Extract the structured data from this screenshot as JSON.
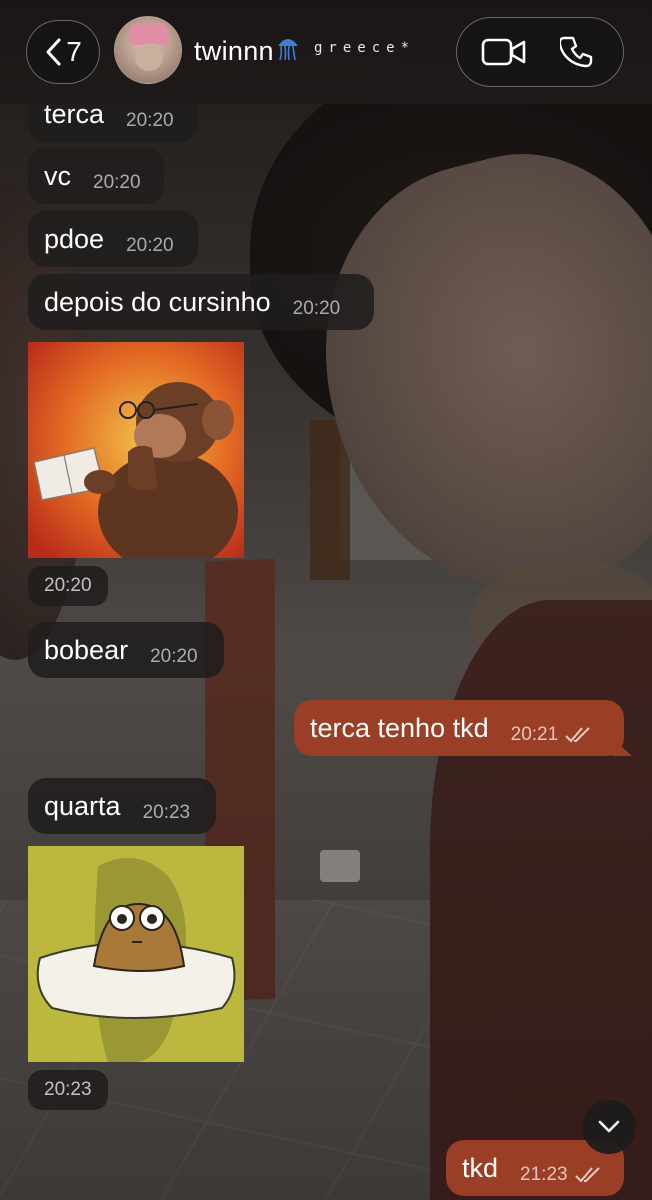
{
  "header": {
    "back_count": "7",
    "contact_name": "twinnn",
    "status": "greece*",
    "icons": {
      "back": "chevron-left-icon",
      "video": "video-camera-icon",
      "call": "phone-icon",
      "name_emoji": "jellyfish-emoji"
    }
  },
  "messages": [
    {
      "direction": "in",
      "text": "terca",
      "time": "20:20"
    },
    {
      "direction": "in",
      "text": "vc",
      "time": "20:20"
    },
    {
      "direction": "in",
      "text": "pdoe",
      "time": "20:20"
    },
    {
      "direction": "in",
      "text": "depois do cursinho",
      "time": "20:20"
    },
    {
      "direction": "in",
      "type": "sticker",
      "sticker": "monkey-reading-book",
      "time": "20:20"
    },
    {
      "direction": "in",
      "text": "bobear",
      "time": "20:20"
    },
    {
      "direction": "out",
      "text": "terca tenho tkd",
      "time": "20:21",
      "status": "read"
    },
    {
      "direction": "in",
      "text": "quarta",
      "time": "20:23"
    },
    {
      "direction": "in",
      "type": "sticker",
      "sticker": "pou-on-pillow",
      "time": "20:23"
    },
    {
      "direction": "out",
      "text": "tkd",
      "time": "21:23",
      "status": "read"
    }
  ],
  "colors": {
    "outgoing_bubble": "#9a3f25",
    "incoming_bubble": "#201e1d"
  }
}
